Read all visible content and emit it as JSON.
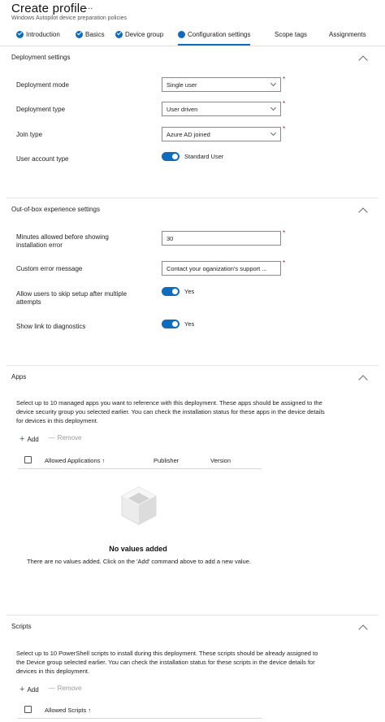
{
  "header": {
    "title": "Create profile",
    "more": "...",
    "subtitle": "Windows Autopilot device preparation policies"
  },
  "tabs": [
    {
      "label": "Introduction",
      "state": "complete"
    },
    {
      "label": "Basics",
      "state": "complete"
    },
    {
      "label": "Device group",
      "state": "complete"
    },
    {
      "label": "Configuration settings",
      "state": "active"
    },
    {
      "label": "Scope tags",
      "state": "pending"
    },
    {
      "label": "Assignments",
      "state": "pending"
    }
  ],
  "deployment": {
    "title": "Deployment settings",
    "mode_label": "Deployment mode",
    "mode_value": "Single user",
    "type_label": "Deployment type",
    "type_value": "User driven",
    "join_label": "Join type",
    "join_value": "Azure AD joined",
    "account_label": "User account type",
    "account_value": "Standard User"
  },
  "oobe": {
    "title": "Out-of-box experience settings",
    "minutes_label": "Minutes allowed before showing installation error",
    "minutes_value": "30",
    "error_label": "Custom error message",
    "error_value": "Contact your oganization's support ...",
    "skip_label": "Allow users to skip setup after multiple attempts",
    "skip_value": "Yes",
    "diag_label": "Show link to diagnostics",
    "diag_value": "Yes"
  },
  "apps": {
    "title": "Apps",
    "description": "Select up to 10 managed apps you want to reference with this deployment. These apps should be assigned to the device security group you selected earlier. You can check the installation status for these apps in the device details for devices in this deployment.",
    "add_label": "Add",
    "remove_label": "Remove",
    "columns": [
      "Allowed Applications ↑",
      "Publisher",
      "Version"
    ],
    "empty_title": "No values added",
    "empty_desc": "There are no values added. Click on the 'Add' command above to add a new value."
  },
  "scripts": {
    "title": "Scripts",
    "description": "Select up to 10 PowerShell scripts to install during this deployment. These scripts should be already assigned to the Device group selected earlier. You can check the installation status for these scripts in the device details for devices in this deployment.",
    "add_label": "Add",
    "remove_label": "Remove",
    "columns": [
      "Allowed Scripts ↑"
    ]
  },
  "colors": {
    "accent": "#0f6cbd",
    "required": "#c50f1f"
  }
}
